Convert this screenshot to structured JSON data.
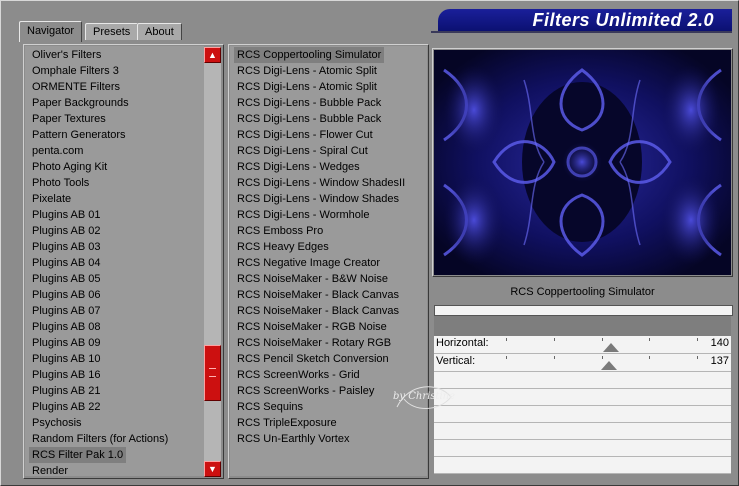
{
  "window": {
    "title": "Filters Unlimited 2.0"
  },
  "tabs": [
    {
      "label": "Navigator",
      "active": true
    },
    {
      "label": "Presets",
      "active": false
    },
    {
      "label": "About",
      "active": false
    }
  ],
  "category_list": {
    "items": [
      "Oliver's Filters",
      "Omphale Filters 3",
      "ORMENTE Filters",
      "Paper Backgrounds",
      "Paper Textures",
      "Pattern Generators",
      "penta.com",
      "Photo Aging Kit",
      "Photo Tools",
      "Pixelate",
      "Plugins AB 01",
      "Plugins AB 02",
      "Plugins AB 03",
      "Plugins AB 04",
      "Plugins AB 05",
      "Plugins AB 06",
      "Plugins AB 07",
      "Plugins AB 08",
      "Plugins AB 09",
      "Plugins AB 10",
      "Plugins AB 16",
      "Plugins AB 21",
      "Plugins AB 22",
      "Psychosis",
      "Random Filters (for Actions)",
      "RCS Filter Pak 1.0",
      "Render"
    ],
    "selected_index": 25
  },
  "filter_list": {
    "items": [
      "RCS Coppertooling Simulator",
      "RCS Digi-Lens - Atomic Split",
      "RCS Digi-Lens - Atomic Split",
      "RCS Digi-Lens - Bubble Pack",
      "RCS Digi-Lens - Bubble Pack",
      "RCS Digi-Lens - Flower Cut",
      "RCS Digi-Lens - Spiral Cut",
      "RCS Digi-Lens - Wedges",
      "RCS Digi-Lens - Window ShadesII",
      "RCS Digi-Lens - Window Shades",
      "RCS Digi-Lens - Wormhole",
      "RCS Emboss Pro",
      "RCS Heavy Edges",
      "RCS Negative Image Creator",
      "RCS NoiseMaker - B&W Noise",
      "RCS NoiseMaker - Black Canvas",
      "RCS NoiseMaker - Black Canvas",
      "RCS NoiseMaker - RGB Noise",
      "RCS NoiseMaker - Rotary RGB",
      "RCS Pencil Sketch Conversion",
      "RCS ScreenWorks - Grid",
      "RCS ScreenWorks - Paisley",
      "RCS Sequins",
      "RCS TripleExposure",
      "RCS Un-Earthly Vortex"
    ],
    "selected_index": 0
  },
  "preview": {
    "filter_name": "RCS Coppertooling Simulator"
  },
  "sliders": [
    {
      "label": "Horizontal:",
      "value": "140",
      "position": 0.55
    },
    {
      "label": "Vertical:",
      "value": "137",
      "position": 0.54
    }
  ],
  "watermark": "by Christine",
  "colors": {
    "accent": "#0b1070",
    "scroll": "#cc1010"
  }
}
